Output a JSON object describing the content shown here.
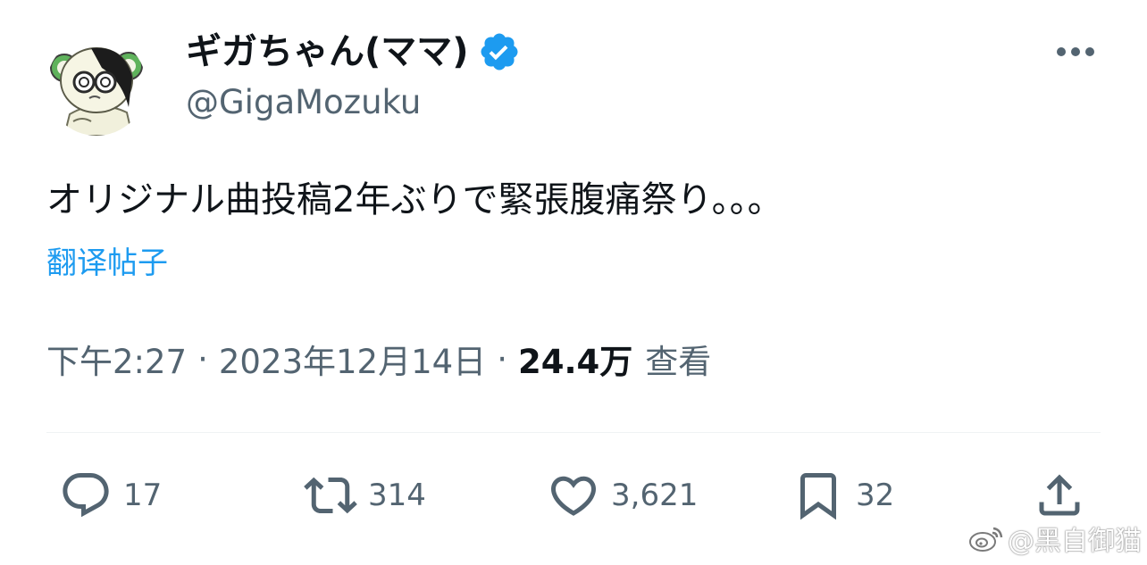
{
  "tweet": {
    "display_name": "ギガちゃん(ママ)",
    "handle": "@GigaMozuku",
    "text": "オリジナル曲投稿2年ぶりで緊張腹痛祭り。。。",
    "translate_label": "翻译帖子",
    "time": "下午2:27",
    "date": "2023年12月14日",
    "separator": "·",
    "views_count": "24.4万",
    "views_label": "查看"
  },
  "actions": {
    "replies": "17",
    "retweets": "314",
    "likes": "3,621",
    "bookmarks": "32"
  },
  "watermark": {
    "text": "@黑自御猫"
  },
  "colors": {
    "text_primary": "#0f1419",
    "text_secondary": "#536471",
    "link": "#1d9bf0",
    "verified": "#1d9bf0",
    "divider": "#eff3f4"
  },
  "icons": {
    "verified": "verified-badge-icon",
    "more": "more-horizontal-icon",
    "reply": "reply-icon",
    "retweet": "retweet-icon",
    "like": "heart-icon",
    "bookmark": "bookmark-icon",
    "share": "share-icon"
  }
}
